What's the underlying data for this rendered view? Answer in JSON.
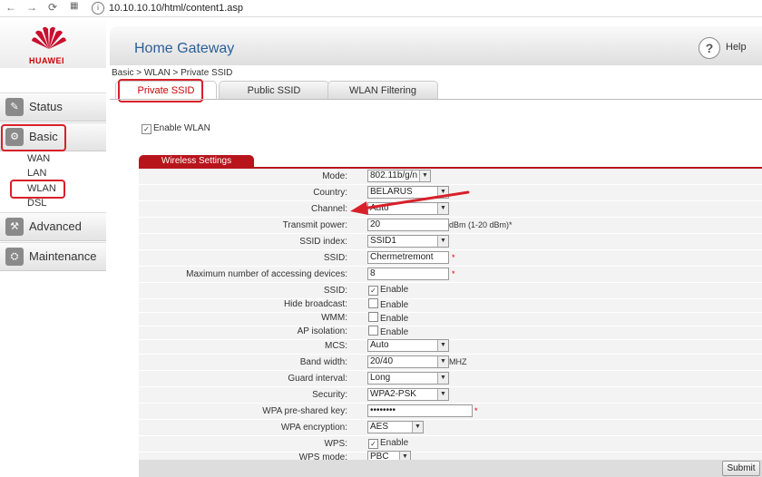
{
  "browser": {
    "url": "10.10.10.10/html/content1.asp"
  },
  "brand": {
    "logo_text": "HUAWEI",
    "brand_color": "#c8102e"
  },
  "sidebar": {
    "items": [
      {
        "label": "Status",
        "icon": "status-icon"
      },
      {
        "label": "Basic",
        "icon": "gear-icon"
      },
      {
        "label": "Advanced",
        "icon": "advanced-icon"
      },
      {
        "label": "Maintenance",
        "icon": "maintenance-icon"
      }
    ],
    "basic_subitems": [
      "WAN",
      "LAN",
      "WLAN",
      "DSL"
    ]
  },
  "header": {
    "title": "Home Gateway",
    "help_label": "Help",
    "help_icon": "?"
  },
  "breadcrumb": "Basic > WLAN > Private SSID",
  "tabs": [
    {
      "label": "Private SSID",
      "active": true
    },
    {
      "label": "Public SSID",
      "active": false
    },
    {
      "label": "WLAN Filtering",
      "active": false
    }
  ],
  "enable_wlan": {
    "label": "Enable WLAN",
    "checked": true
  },
  "section_title": "Wireless Settings",
  "form": {
    "mode": {
      "label": "Mode:",
      "value": "802.11b/g/n"
    },
    "country": {
      "label": "Country:",
      "value": "BELARUS"
    },
    "channel": {
      "label": "Channel:",
      "value": "Auto"
    },
    "transmit_power": {
      "label": "Transmit power:",
      "value": "20",
      "hint": "dBm (1-20 dBm)*"
    },
    "ssid_index": {
      "label": "SSID index:",
      "value": "SSID1"
    },
    "ssid": {
      "label": "SSID:",
      "value": "Chermetremont",
      "req": "*"
    },
    "max_devices": {
      "label": "Maximum number of accessing devices:",
      "value": "8",
      "req": "*"
    },
    "ssid_enable": {
      "label": "SSID:",
      "checkbox_label": "Enable",
      "checked": true
    },
    "hide_broadcast": {
      "label": "Hide broadcast:",
      "checkbox_label": "Enable",
      "checked": false
    },
    "wmm": {
      "label": "WMM:",
      "checkbox_label": "Enable",
      "checked": false
    },
    "ap_isolation": {
      "label": "AP isolation:",
      "checkbox_label": "Enable",
      "checked": false
    },
    "mcs": {
      "label": "MCS:",
      "value": "Auto"
    },
    "band_width": {
      "label": "Band width:",
      "value": "20/40",
      "unit": "MHZ"
    },
    "guard_interval": {
      "label": "Guard interval:",
      "value": "Long"
    },
    "security": {
      "label": "Security:",
      "value": "WPA2-PSK"
    },
    "psk": {
      "label": "WPA pre-shared key:",
      "value": "••••••••",
      "req": "*"
    },
    "wpa_encryption": {
      "label": "WPA encryption:",
      "value": "AES"
    },
    "wps": {
      "label": "WPS:",
      "checkbox_label": "Enable",
      "checked": true
    },
    "wps_mode": {
      "label": "WPS mode:",
      "value": "PBC"
    }
  },
  "submit_label": "Submit",
  "select_arrow": "▼",
  "check_mark": "✓",
  "annotation_color": "#d8202a"
}
